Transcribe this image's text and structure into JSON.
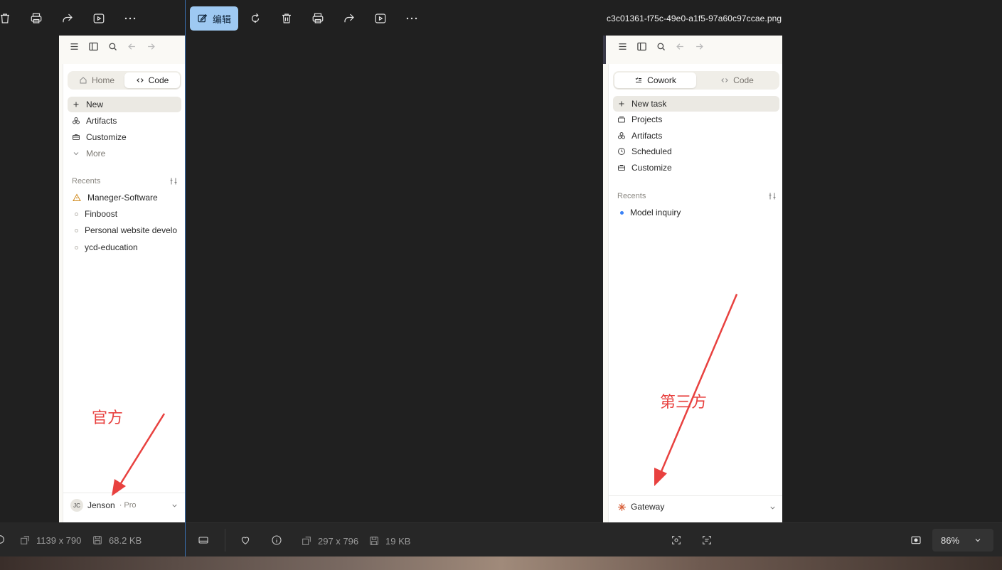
{
  "viewer_left": {
    "info": {
      "dimensions": "1139 x 790",
      "size": "68.2 KB"
    }
  },
  "viewer_center": {
    "edit_label": "编辑",
    "file_name": "c3c01361-f75c-49e0-a1f5-97a60c97ccae.png",
    "info": {
      "dimensions": "297 x 796",
      "size": "19 KB"
    },
    "zoom": "86%"
  },
  "panel_official": {
    "tabs": [
      "Home",
      "Code"
    ],
    "active_tab": "Code",
    "menu": [
      "New",
      "Artifacts",
      "Customize",
      "More"
    ],
    "recents_label": "Recents",
    "recents": [
      "Maneger-Software",
      "Finboost",
      "Personal website develo",
      "ycd-education"
    ],
    "user_initials": "JC",
    "user_name": "Jenson",
    "user_plan": "· Pro",
    "annotation": "官方"
  },
  "panel_thirdparty": {
    "tabs": [
      "Cowork",
      "Code"
    ],
    "active_tab": "Cowork",
    "menu": [
      "New task",
      "Projects",
      "Artifacts",
      "Scheduled",
      "Customize"
    ],
    "recents_label": "Recents",
    "recents": [
      "Model inquiry"
    ],
    "account_name": "Gateway",
    "annotation": "第三方"
  },
  "colors": {
    "accent": "#9ec9f2",
    "annotation": "#e8413f",
    "active_dot": "#3b82f6"
  }
}
